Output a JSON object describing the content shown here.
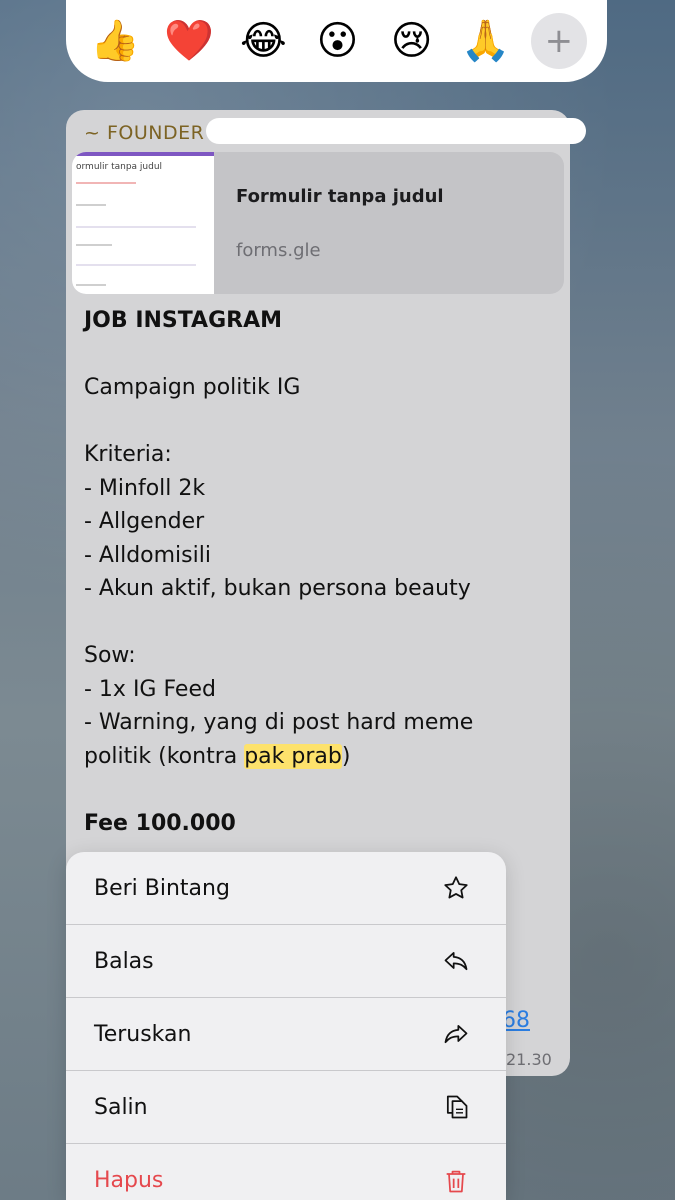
{
  "reactions": [
    "👍",
    "❤️",
    "😂",
    "😮",
    "😢",
    "🙏"
  ],
  "reaction_add": "+",
  "message": {
    "sender": "~ FOUNDER",
    "link_preview": {
      "title": "Formulir tanpa judul",
      "domain": "forms.gle",
      "thumb_title": "ormulir tanpa judul"
    },
    "lines": {
      "heading": "JOB INSTAGRAM",
      "campaign": "Campaign politik IG",
      "kriteria": "Kriteria:",
      "k1": "- Minfoll 2k",
      "k2": "- Allgender",
      "k3": "- Alldomisili",
      "k4": "- Akun aktif, bukan persona beauty",
      "sow": "Sow:",
      "s1": "- 1x IG Feed",
      "s2a": "- Warning, yang di post hard meme",
      "s2b_pre": "politik (kontra ",
      "s2b_hl": "pak prab",
      "s2b_post": ")",
      "fee": "Fee 100.000"
    },
    "link_tail": "68",
    "time": "21.30"
  },
  "menu": {
    "items": [
      {
        "label": "Beri Bintang",
        "icon": "star-icon"
      },
      {
        "label": "Balas",
        "icon": "reply-icon"
      },
      {
        "label": "Teruskan",
        "icon": "forward-icon"
      },
      {
        "label": "Salin",
        "icon": "copy-icon"
      },
      {
        "label": "Hapus",
        "icon": "trash-icon",
        "color": "#e5484d"
      }
    ]
  }
}
